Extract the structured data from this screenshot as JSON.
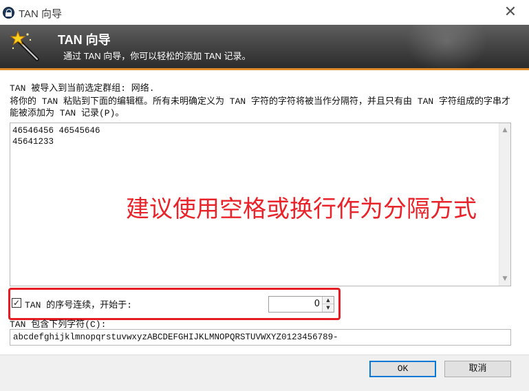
{
  "window": {
    "title": "TAN 向导",
    "close_glyph": "✕"
  },
  "banner": {
    "title": "TAN 向导",
    "subtitle": "通过 TAN 向导，你可以轻松的添加 TAN 记录。",
    "icon": "magic-wand-icon"
  },
  "info": {
    "line1": "TAN 被导入到当前选定群组: 网络.",
    "line2": "将你的 TAN 粘贴到下面的编辑框。所有未明确定义为 TAN 字符的字符将被当作分隔符，并且只有由 TAN 字符组成的字串才能被添加为 TAN 记录(P)。"
  },
  "editor": {
    "content": "46546456 46545646\n45641233"
  },
  "overlay_note": "建议使用空格或换行作为分隔方式",
  "sequential": {
    "checked": true,
    "check_glyph": "✓",
    "label": "TAN 的序号连续，开始于:",
    "start_value": "0"
  },
  "chars": {
    "label": "TAN 包含下列字符(C):",
    "value": "abcdefghijklmnopqrstuvwxyzABCDEFGHIJKLMNOPQRSTUVWXYZ0123456789-"
  },
  "buttons": {
    "ok": "OK",
    "cancel": "取消"
  },
  "colors": {
    "accent_orange": "#e08a2a",
    "annotation_red": "#e51c23",
    "focus_blue": "#0078d7"
  }
}
